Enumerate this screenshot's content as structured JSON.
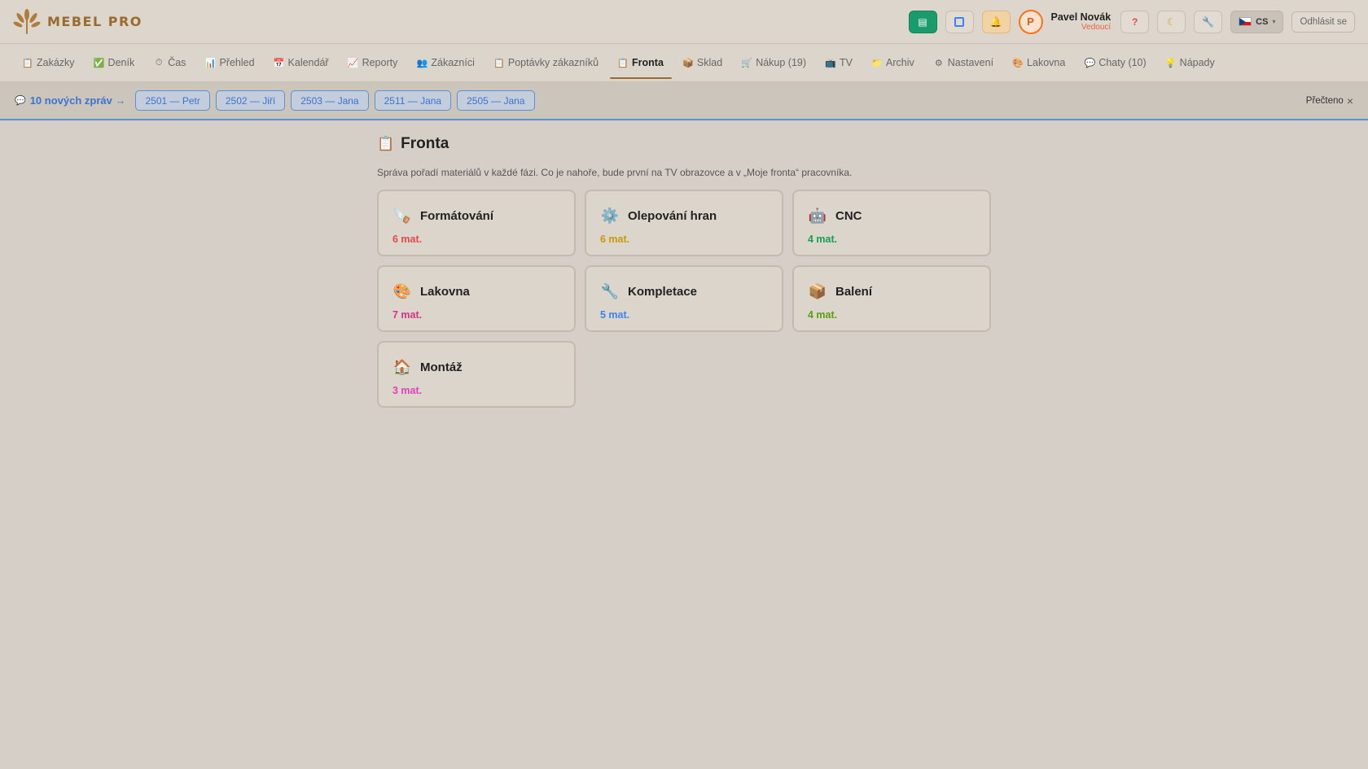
{
  "header": {
    "brand": "MEBEL PRO",
    "user_initial": "P",
    "user_name": "Pavel Novák",
    "user_role": "Vedoucí",
    "help_label": "?",
    "lang_code": "CS",
    "logout_label": "Odhlásit se"
  },
  "nav": [
    {
      "label": "Zakázky",
      "icon": "clipboard-icon"
    },
    {
      "label": "Deník",
      "icon": "check-icon"
    },
    {
      "label": "Čas",
      "icon": "timer-icon"
    },
    {
      "label": "Přehled",
      "icon": "bar-chart-icon"
    },
    {
      "label": "Kalendář",
      "icon": "calendar-icon"
    },
    {
      "label": "Reporty",
      "icon": "line-chart-icon"
    },
    {
      "label": "Zákazníci",
      "icon": "users-icon"
    },
    {
      "label": "Poptávky zákazníků",
      "icon": "clipboard-icon"
    },
    {
      "label": "Fronta",
      "icon": "clipboard-icon",
      "active": true
    },
    {
      "label": "Sklad",
      "icon": "box-icon"
    },
    {
      "label": "Nákup (19)",
      "icon": "cart-icon"
    },
    {
      "label": "TV",
      "icon": "tv-icon"
    },
    {
      "label": "Archiv",
      "icon": "folder-icon"
    },
    {
      "label": "Nastavení",
      "icon": "gear-icon"
    },
    {
      "label": "Lakovna",
      "icon": "palette-icon"
    },
    {
      "label": "Chaty (10)",
      "icon": "chat-icon"
    },
    {
      "label": "Nápady",
      "icon": "bulb-icon"
    }
  ],
  "messages": {
    "count_label": "10 nových zpráv →",
    "chips": [
      "2501 — Petr",
      "2502 — Jiří",
      "2503 — Jana",
      "2511 — Jana",
      "2505 — Jana"
    ],
    "read_label": "Přečteno"
  },
  "page": {
    "title": "Fronta",
    "description": "Správa pořadí materiálů v každé fázi. Co je nahoře, bude první na TV obrazovce a v „Moje fronta“ pracovníka."
  },
  "phases": [
    {
      "name": "Formátování",
      "count": "6 mat.",
      "color": "#e5484d",
      "icon": "saw-icon",
      "glyph": "🪚"
    },
    {
      "name": "Olepování hran",
      "count": "6 mat.",
      "color": "#c99a06",
      "icon": "gear-icon",
      "glyph": "⚙️"
    },
    {
      "name": "CNC",
      "count": "4 mat.",
      "color": "#12a150",
      "icon": "robot-icon",
      "glyph": "🤖"
    },
    {
      "name": "Lakovna",
      "count": "7 mat.",
      "color": "#d63384",
      "icon": "palette-icon",
      "glyph": "🎨"
    },
    {
      "name": "Kompletace",
      "count": "5 mat.",
      "color": "#3b82f6",
      "icon": "wrench-icon",
      "glyph": "🔧"
    },
    {
      "name": "Balení",
      "count": "4 mat.",
      "color": "#5a9e12",
      "icon": "package-icon",
      "glyph": "📦"
    },
    {
      "name": "Montáž",
      "count": "3 mat.",
      "color": "#e040c0",
      "icon": "house-icon",
      "glyph": "🏠"
    }
  ]
}
